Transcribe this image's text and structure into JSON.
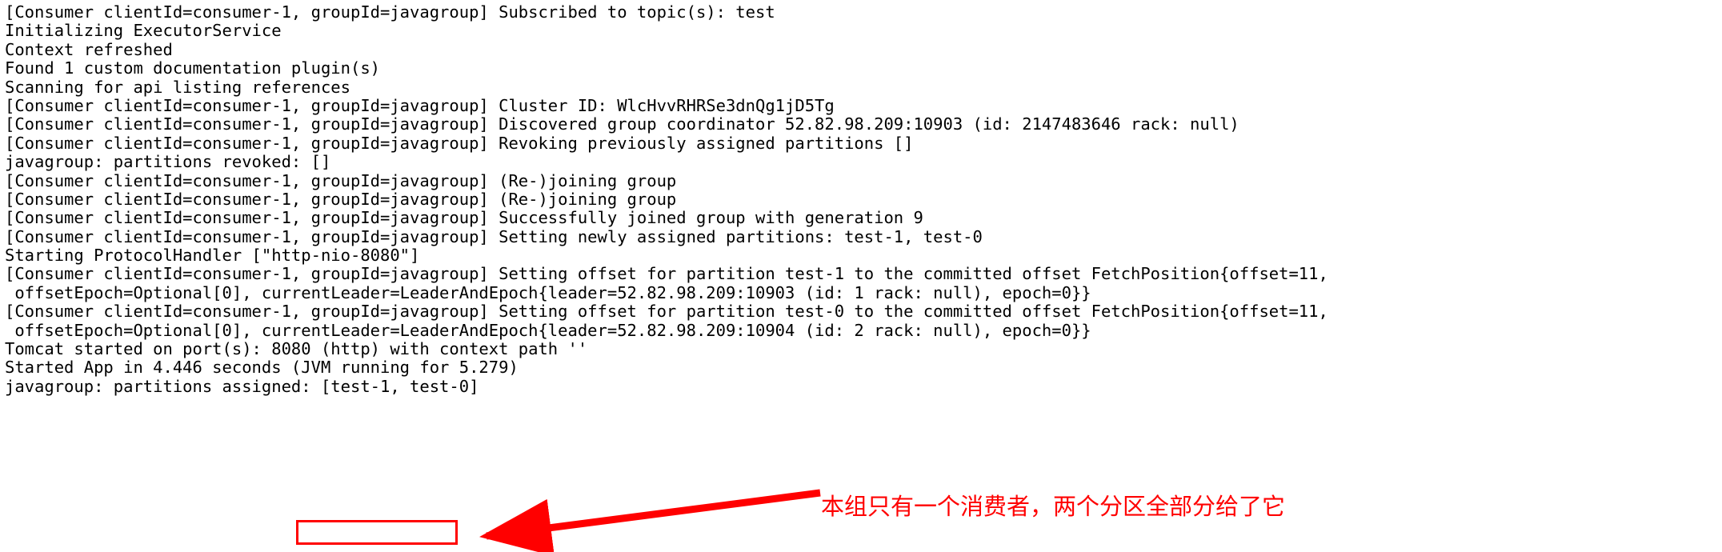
{
  "console": {
    "background_color": "#ffffff",
    "text_color": "#000000",
    "accent_color": "#ff0000",
    "lines": [
      "[Consumer clientId=consumer-1, groupId=javagroup] Subscribed to topic(s): test",
      "Initializing ExecutorService",
      "Context refreshed",
      "Found 1 custom documentation plugin(s)",
      "Scanning for api listing references",
      "[Consumer clientId=consumer-1, groupId=javagroup] Cluster ID: WlcHvvRHRSe3dnQg1jD5Tg",
      "[Consumer clientId=consumer-1, groupId=javagroup] Discovered group coordinator 52.82.98.209:10903 (id: 2147483646 rack: null)",
      "[Consumer clientId=consumer-1, groupId=javagroup] Revoking previously assigned partitions []",
      "javagroup: partitions revoked: []",
      "[Consumer clientId=consumer-1, groupId=javagroup] (Re-)joining group",
      "[Consumer clientId=consumer-1, groupId=javagroup] (Re-)joining group",
      "[Consumer clientId=consumer-1, groupId=javagroup] Successfully joined group with generation 9",
      "[Consumer clientId=consumer-1, groupId=javagroup] Setting newly assigned partitions: test-1, test-0",
      "Starting ProtocolHandler [\"http-nio-8080\"]",
      "[Consumer clientId=consumer-1, groupId=javagroup] Setting offset for partition test-1 to the committed offset FetchPosition{offset=11,",
      " offsetEpoch=Optional[0], currentLeader=LeaderAndEpoch{leader=52.82.98.209:10903 (id: 1 rack: null), epoch=0}}",
      "[Consumer clientId=consumer-1, groupId=javagroup] Setting offset for partition test-0 to the committed offset FetchPosition{offset=11,",
      " offsetEpoch=Optional[0], currentLeader=LeaderAndEpoch{leader=52.82.98.209:10904 (id: 2 rack: null), epoch=0}}",
      "Tomcat started on port(s): 8080 (http) with context path ''",
      "Started App in 4.446 seconds (JVM running for 5.279)",
      "javagroup: partitions assigned: [test-1, test-0]"
    ]
  },
  "annotation": {
    "text": "本组只有一个消费者，两个分区全部分给了它",
    "color": "#ff0000"
  },
  "highlight": {
    "boxed_value": "[test-1, test-0]",
    "box_color": "#ff0000"
  }
}
